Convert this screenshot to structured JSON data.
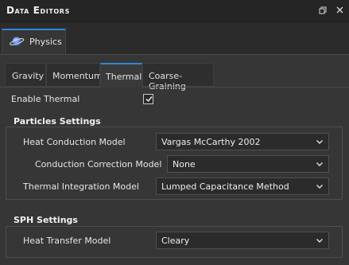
{
  "window": {
    "title": "Data Editors"
  },
  "main_tab": {
    "label": "Physics",
    "icon": "planet-icon"
  },
  "sub_tabs": [
    "Gravity",
    "Momentum",
    "Thermal",
    "Coarse-Graining"
  ],
  "active_sub_tab": "Thermal",
  "enable_thermal": {
    "label": "Enable Thermal",
    "checked": true
  },
  "particles_settings": {
    "title": "Particles Settings",
    "heat_conduction_model": {
      "label": "Heat Conduction Model",
      "value": "Vargas McCarthy 2002"
    },
    "conduction_correction_model": {
      "label": "Conduction Correction Model",
      "value": "None"
    },
    "thermal_integration_model": {
      "label": "Thermal Integration Model",
      "value": "Lumped Capacitance Method"
    }
  },
  "sph_settings": {
    "title": "SPH Settings",
    "heat_transfer_model": {
      "label": "Heat Transfer Model",
      "value": "Cleary"
    }
  },
  "colors": {
    "accent": "#2f87d9",
    "background": "#2b2b2b",
    "panel": "#363636"
  }
}
